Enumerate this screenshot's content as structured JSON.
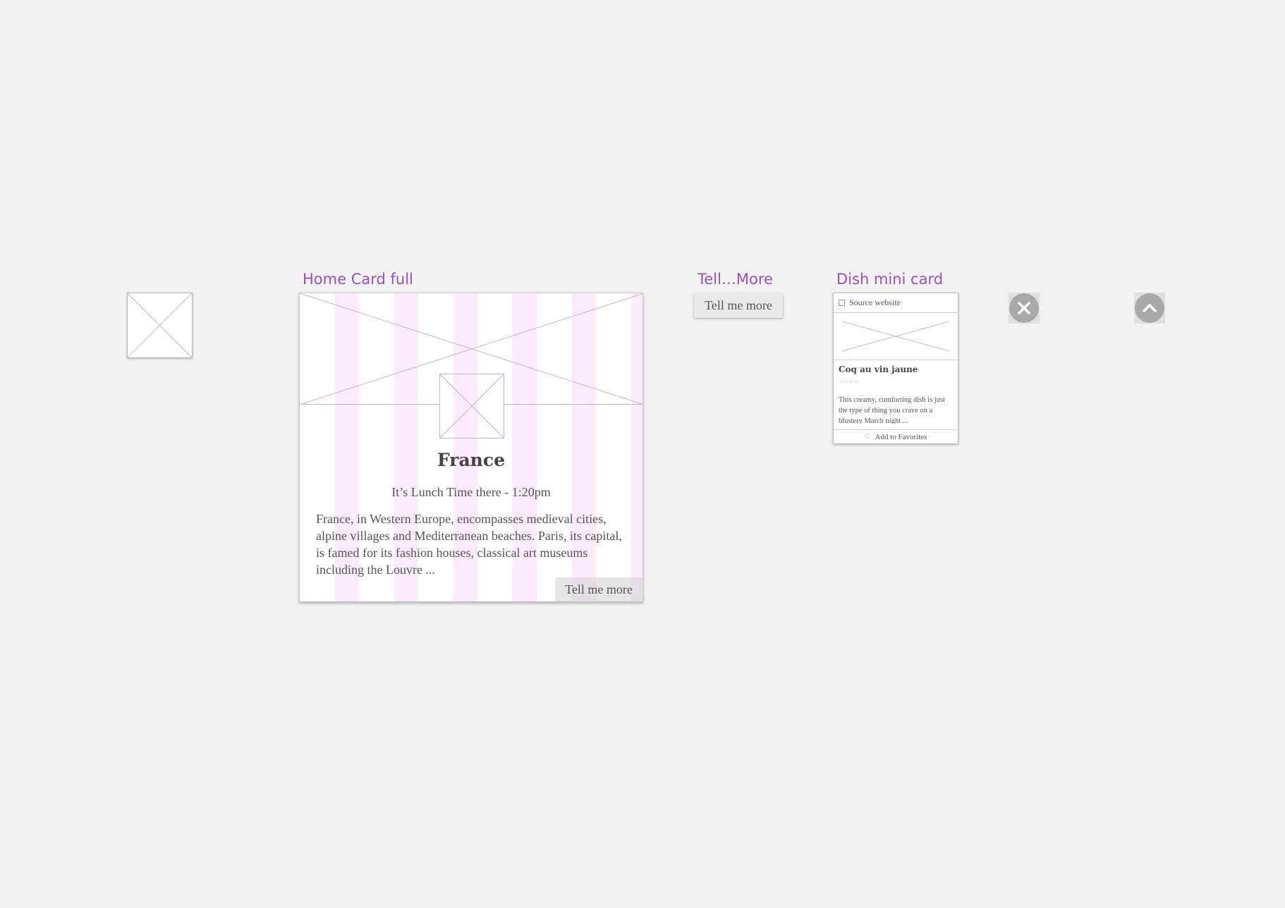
{
  "labels": {
    "home_card": "Home Card full",
    "tell_more": "Tell…More",
    "dish_card": "Dish mini card"
  },
  "home_card": {
    "title": "France",
    "time": "It’s Lunch Time there - 1:20pm",
    "description": "France, in Western Europe, encompasses medieval cities, alpine villages and Mediterranean beaches. Paris, its capital, is famed for its fashion houses, classical art museums including the Louvre ...",
    "cta": "Tell me more"
  },
  "tell_button": {
    "label": "Tell me more"
  },
  "dish_card": {
    "source_label": "Source website",
    "name": "Coq au vin jaune",
    "stars": "☆☆☆☆",
    "description": "This creamy, comforting dish is just the type of thing you crave on a blustery March night ...",
    "favorite_label": "Add to Favorites",
    "favorite_icon": "heart-icon"
  },
  "icons": {
    "close": "close-icon",
    "up": "chevron-up-icon"
  },
  "colors": {
    "label_purple": "#9b4fb8",
    "stripe_pink": "#fdeafc",
    "canvas": "#f2f2f2",
    "icon_grey": "#a9a9a9"
  }
}
